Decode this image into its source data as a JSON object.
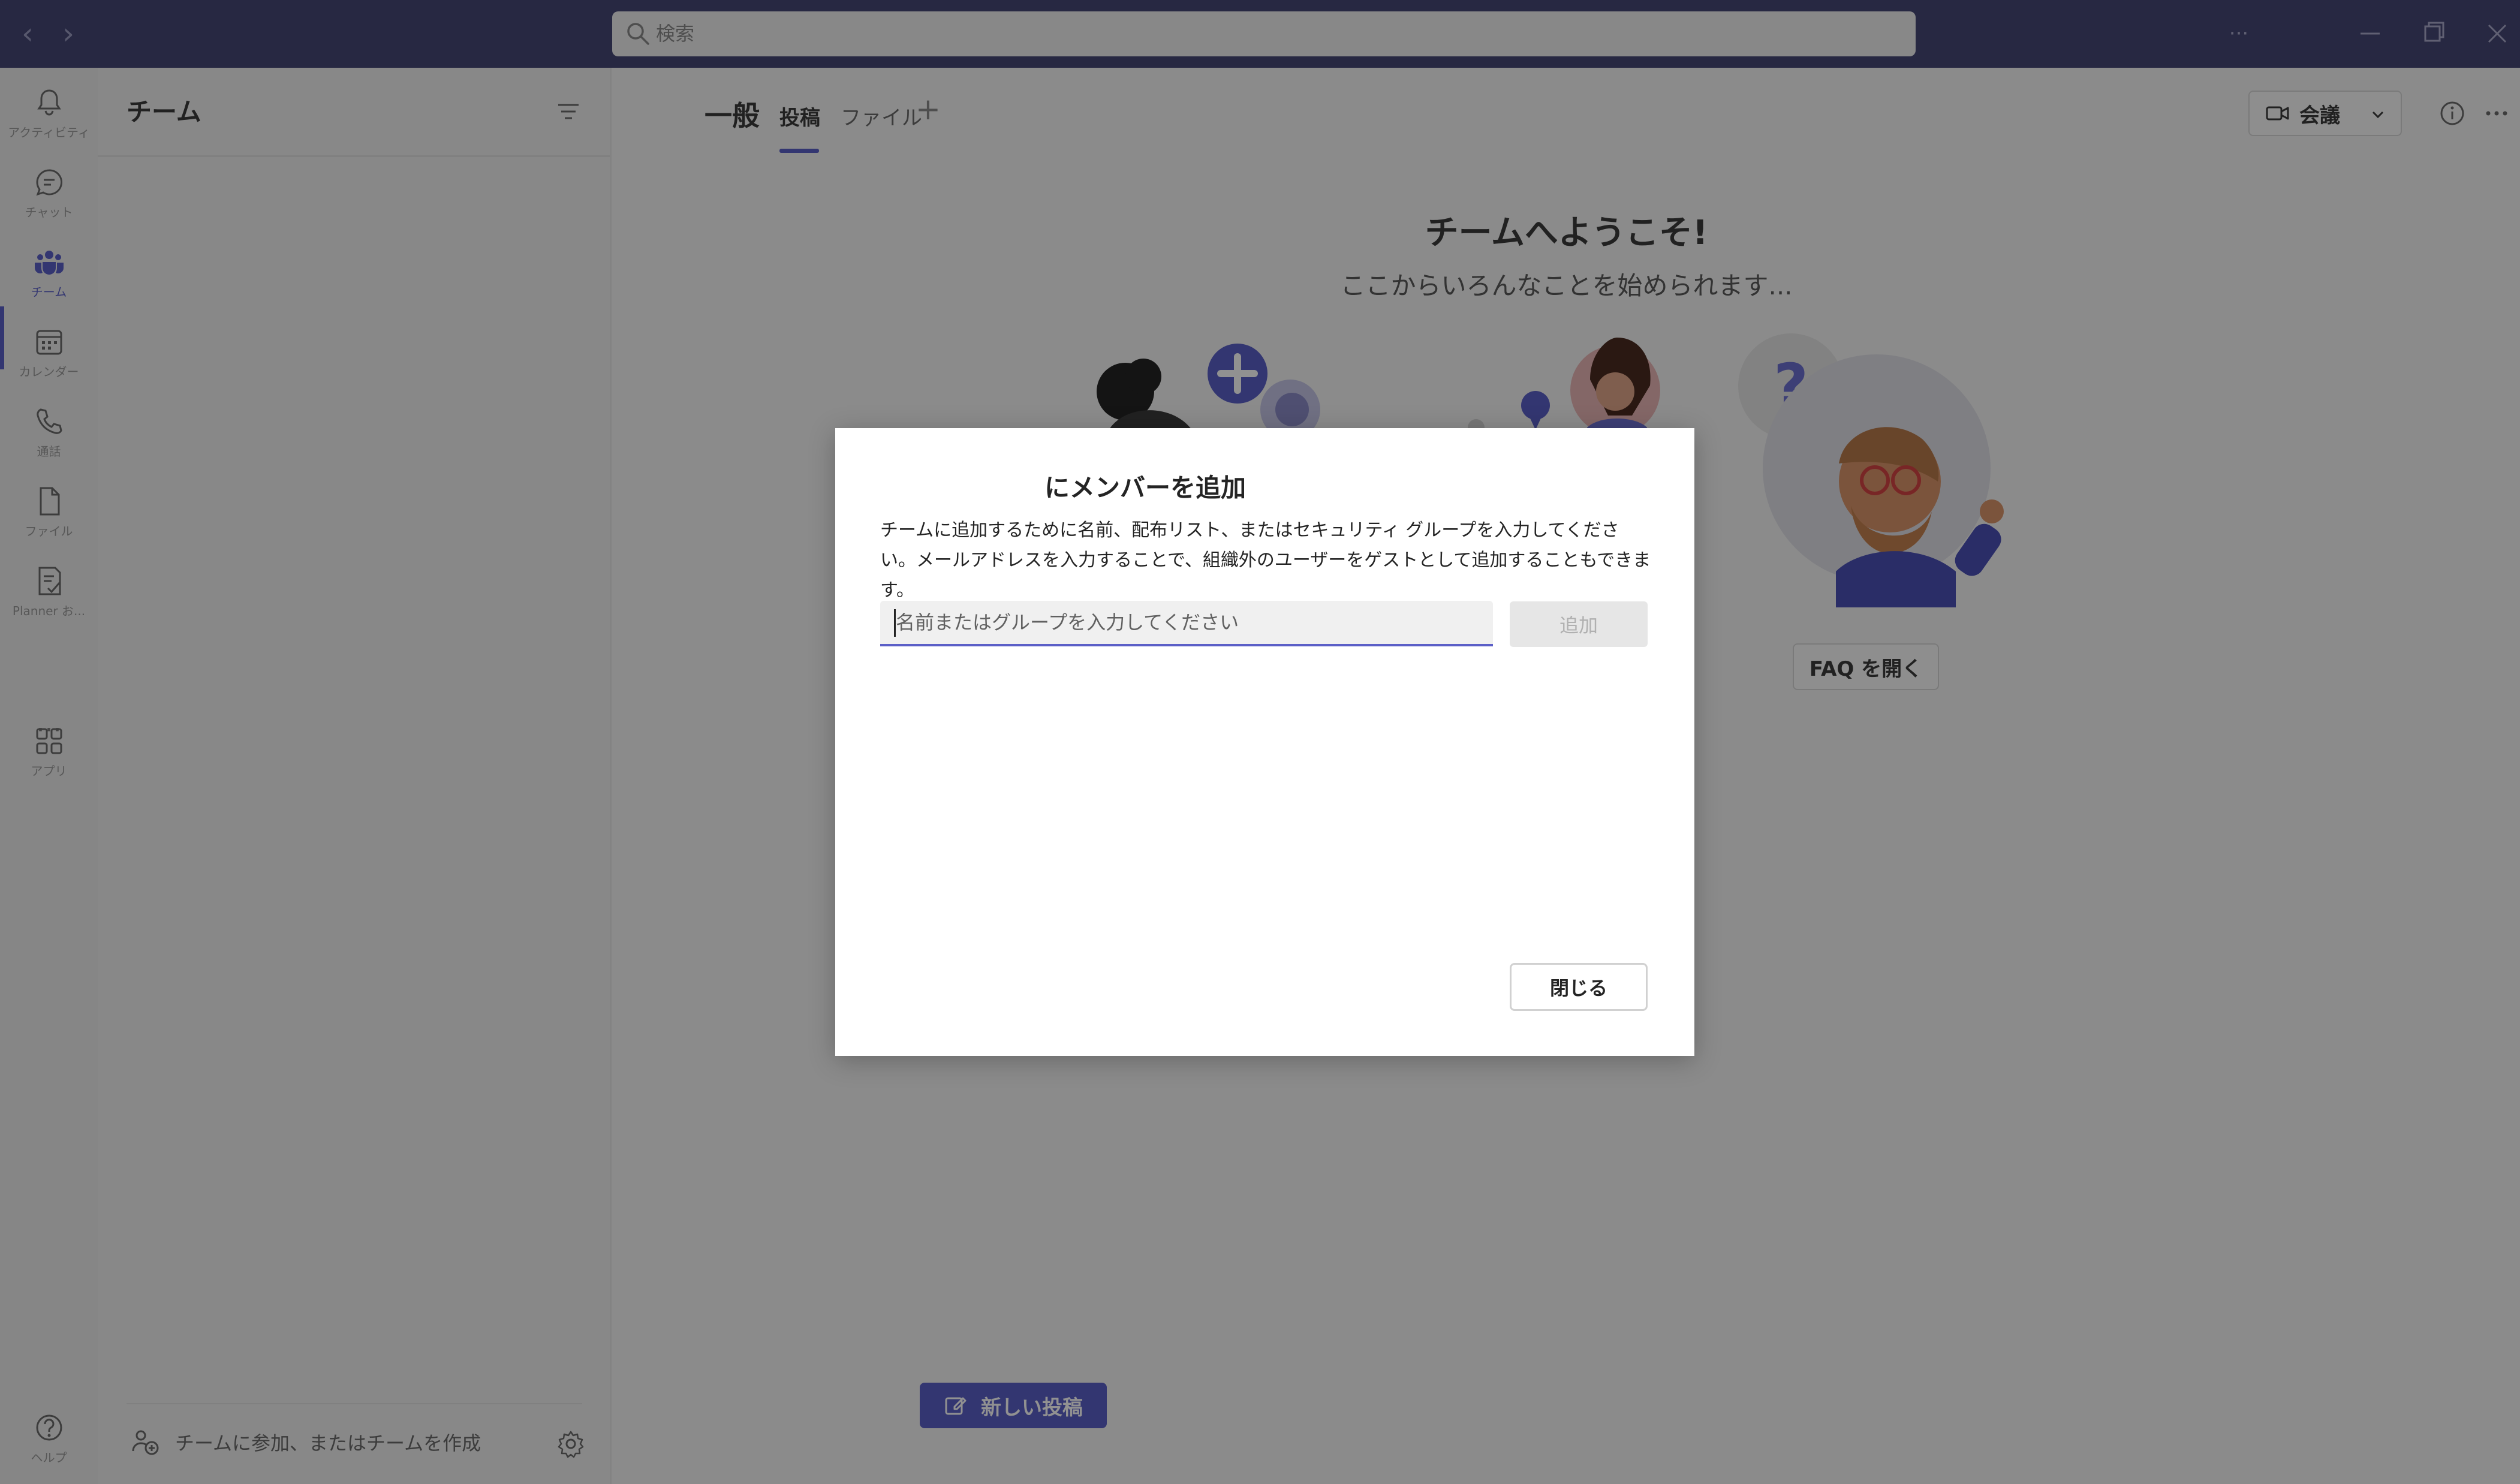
{
  "titlebar": {
    "search_placeholder": "検索",
    "more_label": "···"
  },
  "rail": {
    "items": [
      {
        "id": "activity",
        "label": "アクティビティ",
        "icon": "bell-icon"
      },
      {
        "id": "chat",
        "label": "チャット",
        "icon": "chat-icon"
      },
      {
        "id": "teams",
        "label": "チーム",
        "icon": "teams-icon",
        "active": true
      },
      {
        "id": "calendar",
        "label": "カレンダー",
        "icon": "calendar-icon"
      },
      {
        "id": "calls",
        "label": "通話",
        "icon": "phone-icon"
      },
      {
        "id": "files",
        "label": "ファイル",
        "icon": "file-icon"
      },
      {
        "id": "planner",
        "label": "Planner お...",
        "icon": "planner-icon"
      },
      {
        "id": "apps",
        "label": "アプリ",
        "icon": "apps-icon"
      },
      {
        "id": "help",
        "label": "ヘルプ",
        "icon": "help-icon"
      }
    ],
    "more_label": "···"
  },
  "team_pane": {
    "title": "チーム",
    "join_label": "チームに参加、またはチームを作成"
  },
  "channel": {
    "name": "一般",
    "tabs": [
      {
        "label": "投稿",
        "active": true
      },
      {
        "label": "ファイル",
        "active": false
      }
    ],
    "add_tab": "+",
    "meet_label": "会議"
  },
  "welcome": {
    "title": "チームへようこそ!",
    "subtitle": "ここからいろんなことを始められます...",
    "faq_label": "FAQ を開く",
    "question_mark": "?"
  },
  "new_post_label": "新しい投稿",
  "dialog": {
    "title": "にメンバーを追加",
    "description": "チームに追加するために名前、配布リスト、またはセキュリティ グループを入力してください。メールアドレスを入力することで、組織外のユーザーをゲストとして追加することもできます。",
    "input_placeholder": "名前またはグループを入力してください",
    "input_value": "",
    "add_label": "追加",
    "close_label": "閉じる"
  },
  "colors": {
    "titlebar": "#464775",
    "accent": "#5b5fc7",
    "rail_bg": "#ebebeb"
  }
}
